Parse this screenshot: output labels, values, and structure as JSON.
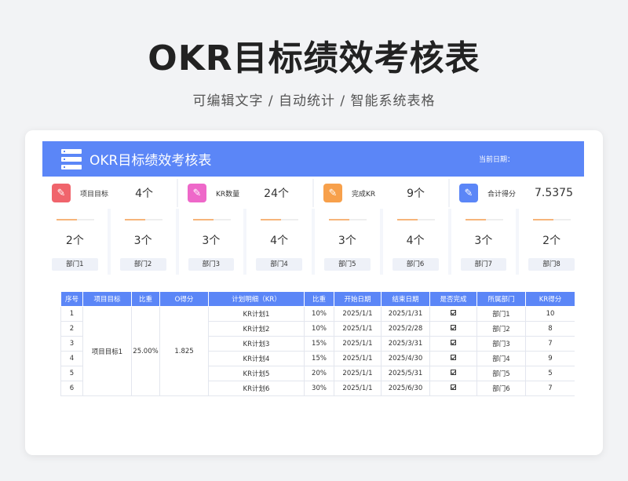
{
  "header": {
    "title": "OKR目标绩效考核表",
    "subtitle": "可编辑文字 / 自动统计 / 智能系统表格"
  },
  "banner": {
    "title": "OKR目标绩效考核表",
    "date_label": "当前日期："
  },
  "stats": [
    {
      "label": "项目目标",
      "value": "4个",
      "color": "#f0646c",
      "icon": "link-icon"
    },
    {
      "label": "KR数量",
      "value": "24个",
      "color": "#ee68c9",
      "icon": "link-icon"
    },
    {
      "label": "完成KR",
      "value": "9个",
      "color": "#f7a04b",
      "icon": "pencil-icon"
    },
    {
      "label": "合计得分",
      "value": "7.5375",
      "color": "#5b86f7",
      "icon": "link-icon"
    }
  ],
  "departments": [
    {
      "count": "2个",
      "name": "部门1"
    },
    {
      "count": "3个",
      "name": "部门2"
    },
    {
      "count": "3个",
      "name": "部门3"
    },
    {
      "count": "4个",
      "name": "部门4"
    },
    {
      "count": "3个",
      "name": "部门5"
    },
    {
      "count": "4个",
      "name": "部门6"
    },
    {
      "count": "3个",
      "name": "部门7"
    },
    {
      "count": "2个",
      "name": "部门8"
    }
  ],
  "table": {
    "headers": [
      "序号",
      "项目目标",
      "比重",
      "O得分",
      "计划明细（KR）",
      "比重",
      "开始日期",
      "结束日期",
      "是否完成",
      "所属部门",
      "KR得分"
    ],
    "group": {
      "objective": "项目目标1",
      "weight": "25.00%",
      "score": "1.825"
    },
    "rows": [
      {
        "no": "1",
        "kr": "KR计划1",
        "weight": "10%",
        "start": "2025/1/1",
        "end": "2025/1/31",
        "dept": "部门1",
        "score": "10"
      },
      {
        "no": "2",
        "kr": "KR计划2",
        "weight": "10%",
        "start": "2025/1/1",
        "end": "2025/2/28",
        "dept": "部门2",
        "score": "8"
      },
      {
        "no": "3",
        "kr": "KR计划3",
        "weight": "15%",
        "start": "2025/1/1",
        "end": "2025/3/31",
        "dept": "部门3",
        "score": "7"
      },
      {
        "no": "4",
        "kr": "KR计划4",
        "weight": "15%",
        "start": "2025/1/1",
        "end": "2025/4/30",
        "dept": "部门4",
        "score": "9"
      },
      {
        "no": "5",
        "kr": "KR计划5",
        "weight": "20%",
        "start": "2025/1/1",
        "end": "2025/5/31",
        "dept": "部门5",
        "score": "5"
      },
      {
        "no": "6",
        "kr": "KR计划6",
        "weight": "30%",
        "start": "2025/1/1",
        "end": "2025/6/30",
        "dept": "部门6",
        "score": "7"
      }
    ]
  }
}
